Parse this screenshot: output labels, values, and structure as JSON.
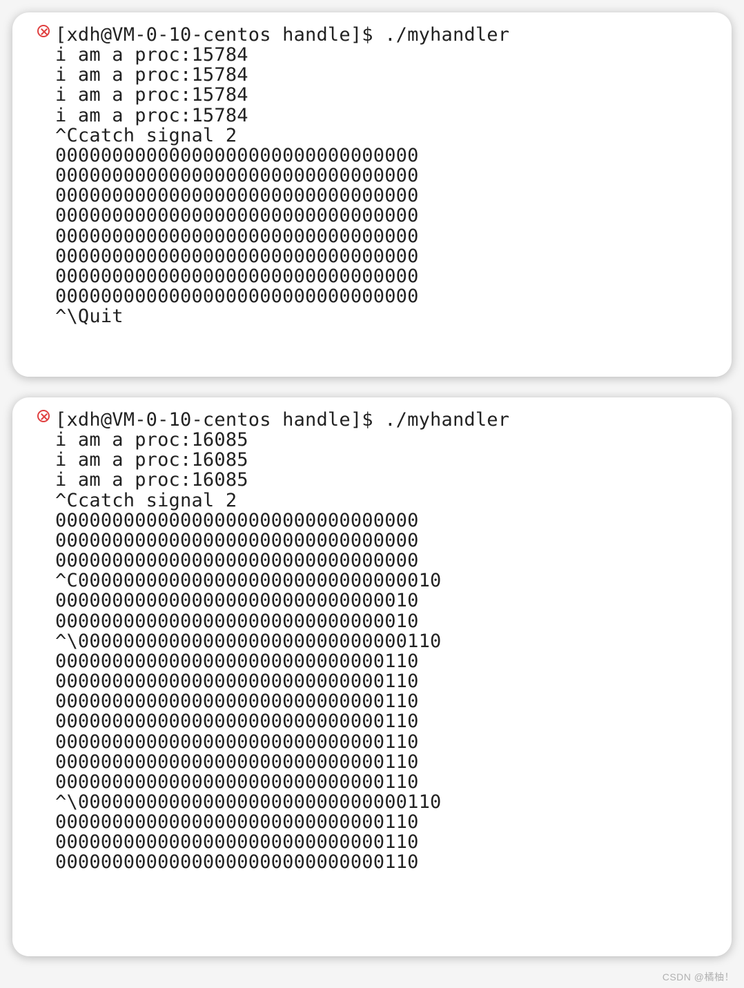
{
  "panel1": {
    "lines": [
      {
        "icon": "error",
        "text": "[xdh@VM-0-10-centos handle]$ ./myhandler"
      },
      {
        "icon": null,
        "text": "i am a proc:15784"
      },
      {
        "icon": null,
        "text": "i am a proc:15784"
      },
      {
        "icon": null,
        "text": "i am a proc:15784"
      },
      {
        "icon": null,
        "text": "i am a proc:15784"
      },
      {
        "icon": null,
        "text": "^Ccatch signal 2"
      },
      {
        "icon": null,
        "text": "00000000000000000000000000000000"
      },
      {
        "icon": null,
        "text": "00000000000000000000000000000000"
      },
      {
        "icon": null,
        "text": "00000000000000000000000000000000"
      },
      {
        "icon": null,
        "text": "00000000000000000000000000000000"
      },
      {
        "icon": null,
        "text": "00000000000000000000000000000000"
      },
      {
        "icon": null,
        "text": "00000000000000000000000000000000"
      },
      {
        "icon": null,
        "text": "00000000000000000000000000000000"
      },
      {
        "icon": null,
        "text": "00000000000000000000000000000000"
      },
      {
        "icon": null,
        "text": "^\\Quit"
      }
    ]
  },
  "panel2": {
    "lines": [
      {
        "icon": "error",
        "text": "[xdh@VM-0-10-centos handle]$ ./myhandler"
      },
      {
        "icon": null,
        "text": "i am a proc:16085"
      },
      {
        "icon": null,
        "text": "i am a proc:16085"
      },
      {
        "icon": null,
        "text": "i am a proc:16085"
      },
      {
        "icon": null,
        "text": "^Ccatch signal 2"
      },
      {
        "icon": null,
        "text": "00000000000000000000000000000000"
      },
      {
        "icon": null,
        "text": "00000000000000000000000000000000"
      },
      {
        "icon": null,
        "text": "00000000000000000000000000000000"
      },
      {
        "icon": null,
        "text": "^C00000000000000000000000000000010"
      },
      {
        "icon": null,
        "text": "00000000000000000000000000000010"
      },
      {
        "icon": null,
        "text": "00000000000000000000000000000010"
      },
      {
        "icon": null,
        "text": "^\\00000000000000000000000000000110"
      },
      {
        "icon": null,
        "text": "00000000000000000000000000000110"
      },
      {
        "icon": null,
        "text": "00000000000000000000000000000110"
      },
      {
        "icon": null,
        "text": "00000000000000000000000000000110"
      },
      {
        "icon": null,
        "text": "00000000000000000000000000000110"
      },
      {
        "icon": null,
        "text": "00000000000000000000000000000110"
      },
      {
        "icon": null,
        "text": "00000000000000000000000000000110"
      },
      {
        "icon": null,
        "text": "00000000000000000000000000000110"
      },
      {
        "icon": null,
        "text": "^\\00000000000000000000000000000110"
      },
      {
        "icon": null,
        "text": "00000000000000000000000000000110"
      },
      {
        "icon": null,
        "text": "00000000000000000000000000000110"
      },
      {
        "icon": null,
        "text": "00000000000000000000000000000110"
      }
    ]
  },
  "watermark": "CSDN @橘柚！"
}
